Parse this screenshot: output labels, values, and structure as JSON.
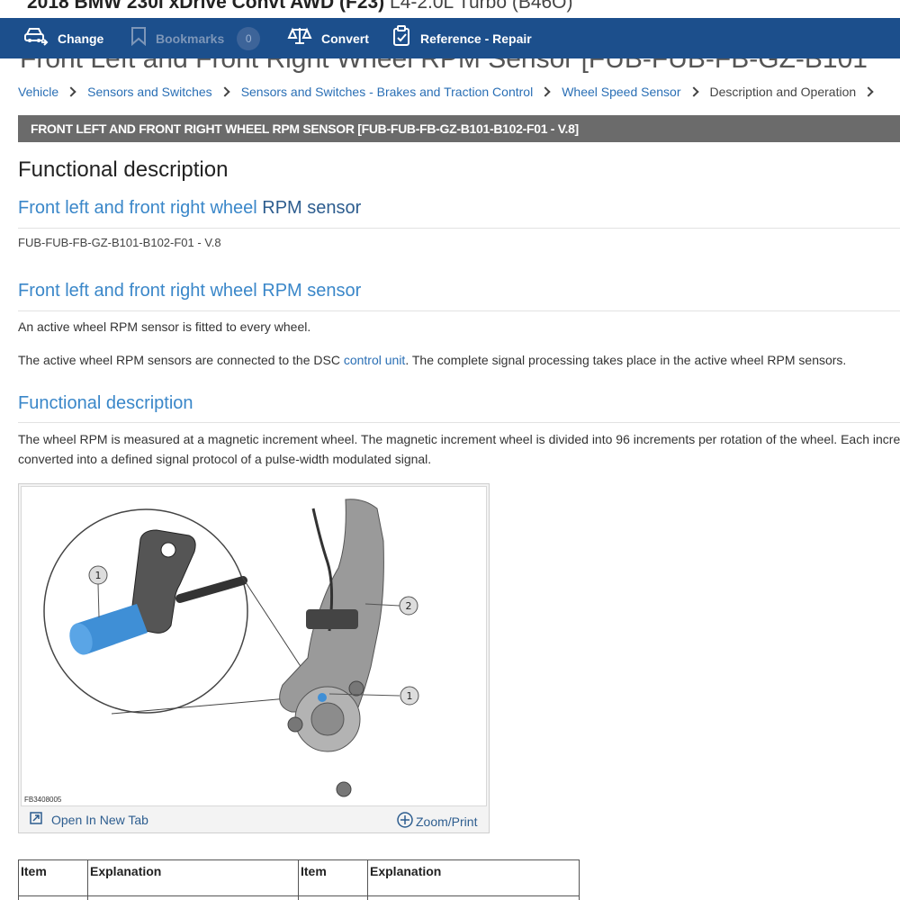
{
  "vehicle": {
    "title": "2018 BMW 230i xDrive Convt AWD (F23)",
    "engine": "L4-2.0L Turbo (B46O)"
  },
  "toolbar": {
    "change": "Change",
    "bookmarks": "Bookmarks",
    "bookmark_count": "0",
    "convert": "Convert",
    "reference": "Reference - Repair"
  },
  "page_heading": "Front Left and Front Right Wheel RPM Sensor [FUB-FUB-FB-GZ-B101",
  "breadcrumb": [
    "Vehicle",
    "Sensors and Switches",
    "Sensors and Switches - Brakes and Traction Control",
    "Wheel Speed Sensor",
    "Description and Operation"
  ],
  "section_bar": "FRONT LEFT AND FRONT RIGHT WHEEL RPM SENSOR [FUB-FUB-FB-GZ-B101-B102-F01 - V.8]",
  "content": {
    "heading_functional": "Functional description",
    "sub1_a": "Front left and front right wheel ",
    "sub1_b": "RPM sensor",
    "code": "FUB-FUB-FB-GZ-B101-B102-F01 - V.8",
    "sub2": "Front left and front right wheel RPM sensor",
    "p1": "An active wheel RPM sensor is fitted to every wheel.",
    "p2_a": "The active wheel RPM sensors are connected to the DSC ",
    "p2_link": "control unit",
    "p2_b": ". The complete signal processing takes place in the active wheel RPM sensors.",
    "sub3": "Functional description",
    "p3_line1": "The wheel RPM is measured at a magnetic increment wheel. The magnetic increment wheel is divided into 96 increments per rotation of the wheel. Each increment is",
    "p3_line2": "converted into a defined signal protocol of a pulse-width modulated signal."
  },
  "figure": {
    "code": "FB3408005",
    "callout_1": "1",
    "callout_2": "2",
    "callout_1b": "1",
    "open_tab": "Open In New Tab",
    "zoom_print": "Zoom/Print"
  },
  "table": {
    "headers": [
      "Item",
      "Explanation",
      "Item",
      "Explanation"
    ]
  }
}
